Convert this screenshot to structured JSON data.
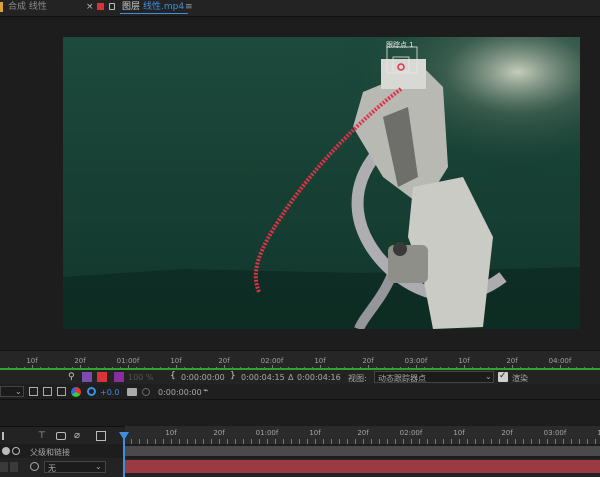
{
  "tabs": {
    "composition": "合成 线性",
    "layer_prefix": "图层",
    "layer_name": "线性.mp4",
    "close": "×",
    "menu": "≡"
  },
  "viewer": {
    "tracker_label": "跟踪点 1"
  },
  "ruler": {
    "labels": [
      "10f",
      "20f",
      "01:00f",
      "10f",
      "20f",
      "02:00f",
      "10f",
      "20f",
      "03:00f",
      "10f",
      "20f",
      "04:00f"
    ]
  },
  "layer_controls": {
    "opacity": "100 %",
    "in_time": "0:00:00:00",
    "out_time": "0:00:04:15",
    "delta_symbol": "Δ",
    "duration": "0:00:04:16",
    "view_label": "视图:",
    "view_value": "动态跟踪器点",
    "render_label": "渲染",
    "offset": "+0.0",
    "timecode": "0:00:00:00"
  },
  "timeline": {
    "ruler_labels": [
      "10f",
      "20f",
      "01:00f",
      "10f",
      "20f",
      "02:00f",
      "10f",
      "20f",
      "03:00f",
      "10f"
    ],
    "parent_label": "父级和链接",
    "parent_value": "无"
  },
  "colors": {
    "accent": "#3d8fe0",
    "green": "#2fa52f",
    "red_layer": "#9a3a42",
    "label_red": "#d9333a"
  }
}
